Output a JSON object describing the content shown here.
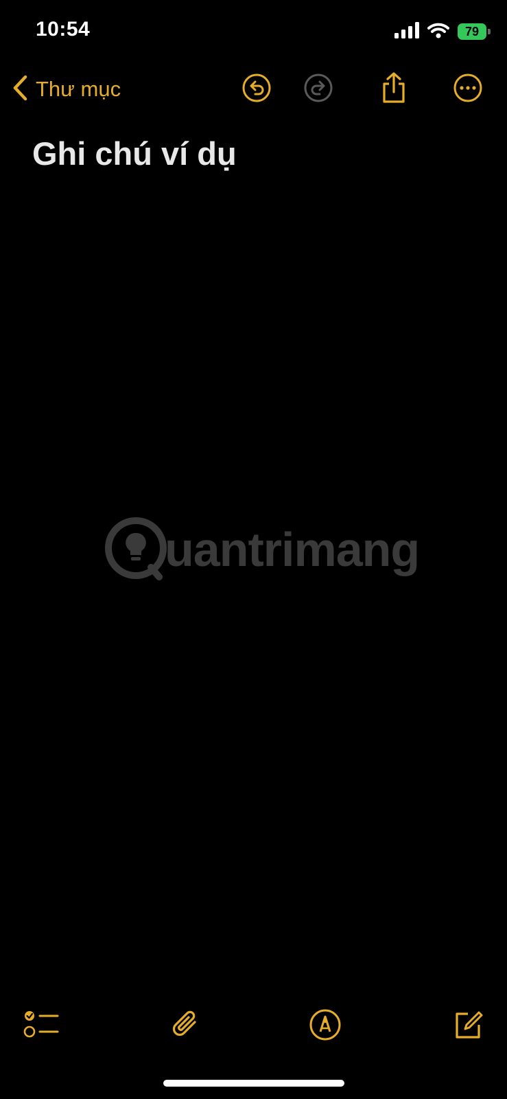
{
  "status_bar": {
    "time": "10:54",
    "battery": "79"
  },
  "nav": {
    "back_label": "Thư mục",
    "icons": [
      "chevron-left-icon",
      "undo-icon",
      "redo-icon",
      "share-icon",
      "more-icon"
    ]
  },
  "note": {
    "title": "Ghi chú ví dụ"
  },
  "watermark": {
    "text": "uantrimang"
  },
  "toolbar": {
    "icons": [
      "checklist-icon",
      "paperclip-icon",
      "markup-pen-icon",
      "compose-icon"
    ]
  },
  "colors": {
    "accent": "#e5ad2b",
    "background": "#000000",
    "battery": "#34c759"
  }
}
